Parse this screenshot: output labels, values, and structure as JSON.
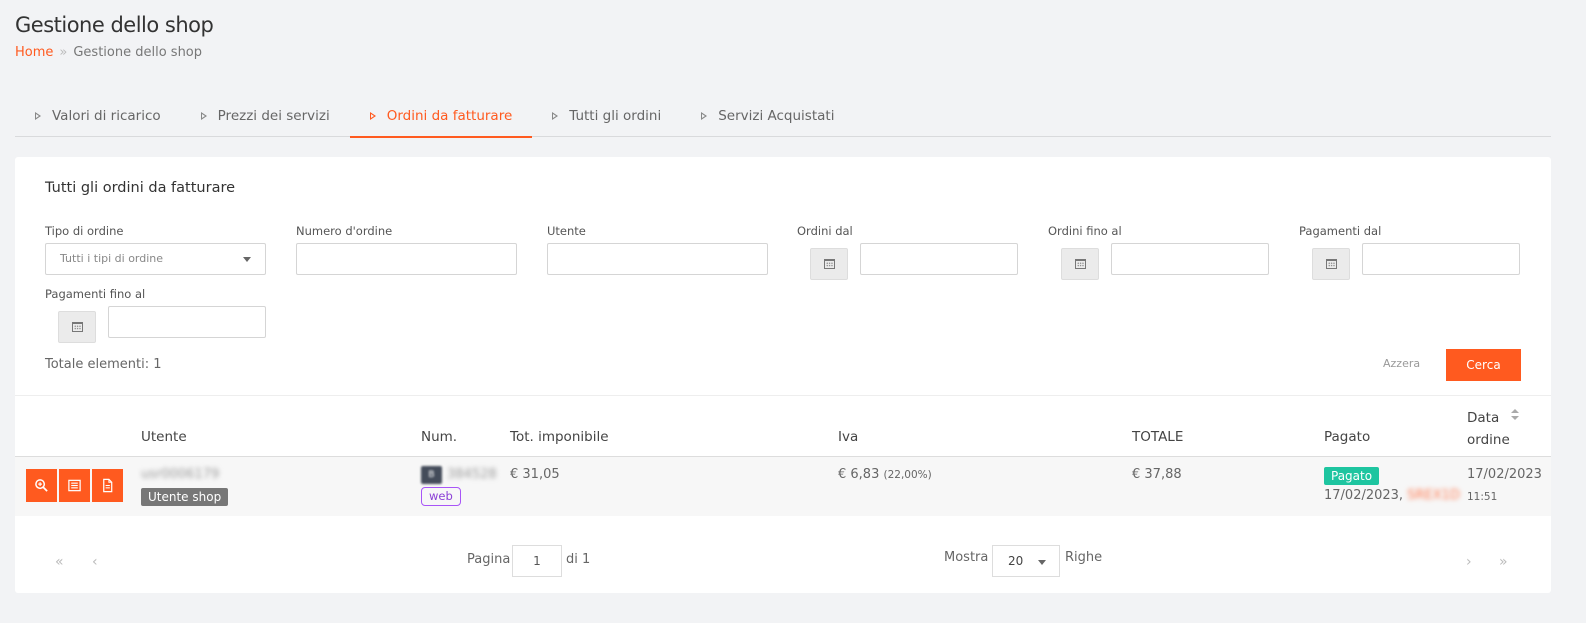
{
  "header": {
    "title": "Gestione dello shop",
    "breadcrumb": {
      "home": "Home",
      "separator": "»",
      "current": "Gestione dello shop"
    }
  },
  "tabs": [
    {
      "label": "Valori di ricarico",
      "active": false
    },
    {
      "label": "Prezzi dei servizi",
      "active": false
    },
    {
      "label": "Ordini da fatturare",
      "active": true
    },
    {
      "label": "Tutti gli ordini",
      "active": false
    },
    {
      "label": "Servizi Acquistati",
      "active": false
    }
  ],
  "card": {
    "title": "Tutti gli ordini da fatturare",
    "filters": {
      "order_type": {
        "label": "Tipo di ordine",
        "value": "Tutti i tipi di ordine"
      },
      "order_number": {
        "label": "Numero d'ordine",
        "value": ""
      },
      "user": {
        "label": "Utente",
        "value": ""
      },
      "orders_from": {
        "label": "Ordini dal",
        "value": ""
      },
      "orders_to": {
        "label": "Ordini fino al",
        "value": ""
      },
      "payments_from": {
        "label": "Pagamenti dal",
        "value": ""
      },
      "payments_to": {
        "label": "Pagamenti fino al",
        "value": ""
      }
    },
    "total_items": "Totale elementi: 1",
    "reset_label": "Azzera",
    "search_label": "Cerca"
  },
  "table": {
    "headers": {
      "user": "Utente",
      "num": "Num.",
      "taxable": "Tot. imponibile",
      "vat": "Iva",
      "total": "TOTALE",
      "paid": "Pagato",
      "date_line1": "Data",
      "date_line2": "ordine"
    },
    "rows": [
      {
        "user": "usr0006179",
        "user_badge": "Utente shop",
        "num_prefix": "B",
        "num": "384528",
        "source": "web",
        "taxable": "€ 31,05",
        "vat": "€ 6,83",
        "vat_rate": "(22,00%)",
        "total": "€ 37,88",
        "paid_badge": "Pagato",
        "paid_date": "17/02/2023,",
        "paid_ref": "SREX1D",
        "order_date": "17/02/2023",
        "order_time": "11:51"
      }
    ]
  },
  "pagination": {
    "first": "«",
    "prev": "‹",
    "next": "›",
    "last": "»",
    "page_label": "Pagina",
    "page_value": "1",
    "of_label": "di 1",
    "show_label": "Mostra",
    "rows_value": "20",
    "rows_label": "Righe"
  },
  "colors": {
    "accent": "#ff5a1f",
    "paid": "#1ec5a0",
    "web": "#a855f7"
  }
}
